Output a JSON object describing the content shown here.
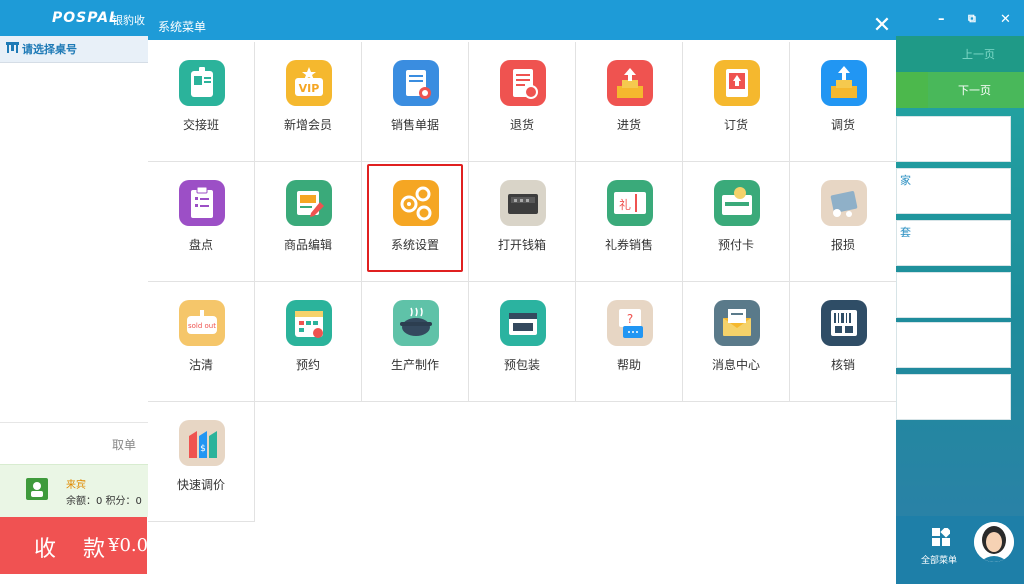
{
  "app": {
    "logo": "POSPAL",
    "logo_sub": "银豹收",
    "table_select": "请选择桌号",
    "cancel_order": "取单",
    "member_name": "来宾",
    "member_detail": "余额：0 积分：0",
    "checkout_label": "收 款",
    "checkout_amount": "¥0.0"
  },
  "right_panel": {
    "prev_page": "上一页",
    "next_page": "下一页",
    "tiles": [
      "",
      "家",
      "套",
      "",
      "",
      ""
    ],
    "all_menu": "全部菜单",
    "win_minimize": "–",
    "win_restore": "⧉",
    "win_close": "✕"
  },
  "modal": {
    "title": "系统菜单",
    "close": "✕",
    "items": [
      {
        "label": "交接班",
        "icon": "id-badge-icon",
        "color": "#2bb39b"
      },
      {
        "label": "新增会员",
        "icon": "vip-icon",
        "color": "#f5b82e"
      },
      {
        "label": "销售单据",
        "icon": "sales-receipt-icon",
        "color": "#3a8de0"
      },
      {
        "label": "退货",
        "icon": "return-icon",
        "color": "#ef5350"
      },
      {
        "label": "进货",
        "icon": "stock-in-icon",
        "color": "#ef5350"
      },
      {
        "label": "订货",
        "icon": "order-icon",
        "color": "#f5b82e"
      },
      {
        "label": "调货",
        "icon": "transfer-icon",
        "color": "#2196f3"
      },
      {
        "label": "盘点",
        "icon": "clipboard-icon",
        "color": "#9c4fc6"
      },
      {
        "label": "商品编辑",
        "icon": "product-edit-icon",
        "color": "#3aaa7a"
      },
      {
        "label": "系统设置",
        "icon": "gears-icon",
        "color": "#f5a623"
      },
      {
        "label": "打开钱箱",
        "icon": "cash-drawer-icon",
        "color": "#d9d4c8"
      },
      {
        "label": "礼券销售",
        "icon": "gift-coupon-icon",
        "color": "#3aaa7a"
      },
      {
        "label": "预付卡",
        "icon": "prepaid-card-icon",
        "color": "#3aaa7a"
      },
      {
        "label": "报损",
        "icon": "damage-report-icon",
        "color": "#e7d6c4"
      },
      {
        "label": "沽清",
        "icon": "sold-out-icon",
        "color": "#f5c66a"
      },
      {
        "label": "预约",
        "icon": "calendar-icon",
        "color": "#2bb39b"
      },
      {
        "label": "生产制作",
        "icon": "cooking-pot-icon",
        "color": "#5fc2a8"
      },
      {
        "label": "预包装",
        "icon": "package-icon",
        "color": "#2bb3a0"
      },
      {
        "label": "帮助",
        "icon": "help-icon",
        "color": "#e7d6c4"
      },
      {
        "label": "消息中心",
        "icon": "message-icon",
        "color": "#5a7a8a"
      },
      {
        "label": "核销",
        "icon": "qr-scan-icon",
        "color": "#2f4d66"
      },
      {
        "label": "快速调价",
        "icon": "price-tag-icon",
        "color": "#e7d6c4"
      }
    ],
    "highlighted_item": "系统设置"
  }
}
